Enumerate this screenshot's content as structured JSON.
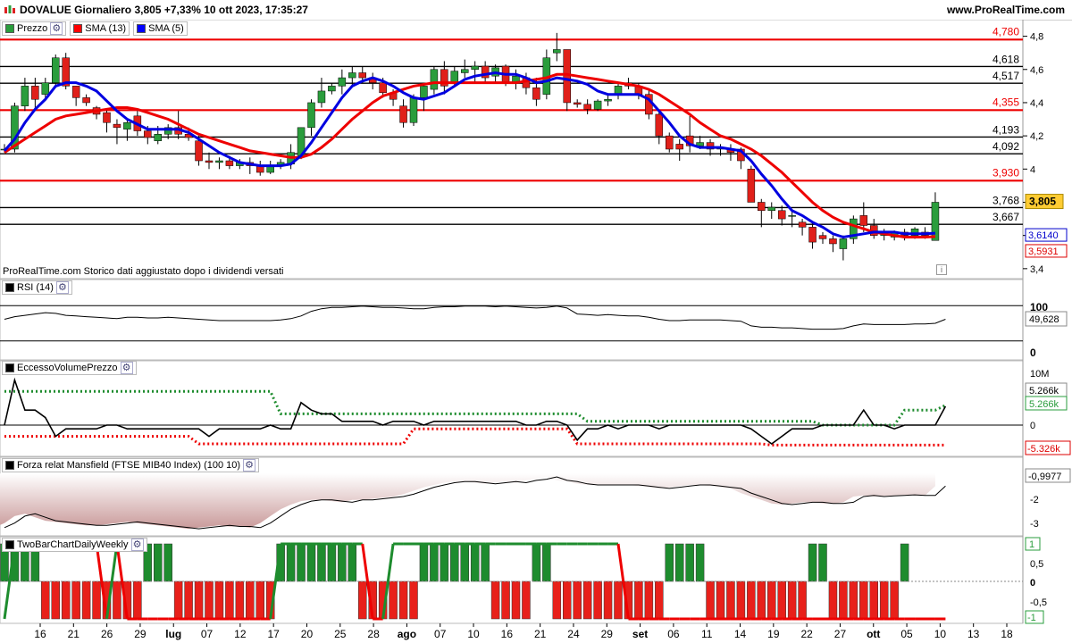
{
  "header": {
    "title": "DOVALUE Giornaliero 3,805 +7,33% 10 ott 2023, 17:35:27",
    "site": "www.ProRealTime.com"
  },
  "price_panel": {
    "legend": [
      {
        "label": "Prezzo",
        "color": "#2a9d3c"
      },
      {
        "label": "SMA (13)",
        "color": "#ff0000"
      },
      {
        "label": "SMA (5)",
        "color": "#0000ff"
      }
    ],
    "note": "ProRealTime.com  Storico dati aggiustato dopo i dividendi versati",
    "info_glyph": "i"
  },
  "rsi_panel": {
    "legend": "RSI (14)",
    "value": "49,628",
    "scale_top": "100",
    "scale_bottom": "0"
  },
  "evp_panel": {
    "legend": "EccessoVolumePrezzo",
    "scale_top": "10M",
    "scale_zero": "0",
    "value_black": "5.266k",
    "value_green": "5.266k",
    "value_red": "-5.326k"
  },
  "mansfield_panel": {
    "legend": "Forza relat Mansfield (FTSE MIB40 Index) (100 10)",
    "value": "-0,9977",
    "ticks": [
      "-2",
      "-3"
    ]
  },
  "twobar_panel": {
    "legend": "TwoBarChartDailyWeekly",
    "value_top": "1",
    "value_bottom": "-1",
    "ticks": [
      "0,5",
      "0",
      "-0,5"
    ]
  },
  "xaxis": {
    "labels": [
      "16",
      "21",
      "26",
      "29",
      "lug",
      "07",
      "12",
      "17",
      "20",
      "25",
      "28",
      "ago",
      "07",
      "10",
      "16",
      "21",
      "24",
      "29",
      "set",
      "06",
      "11",
      "14",
      "19",
      "22",
      "27",
      "ott",
      "05",
      "10",
      "13",
      "18"
    ],
    "bold": [
      "lug",
      "ago",
      "set",
      "ott"
    ]
  },
  "chart_data": {
    "type": "candlestick",
    "price_ticks": [
      4.8,
      4.6,
      4.4,
      4.2,
      4.0,
      3.8,
      3.6,
      3.4
    ],
    "price_tick_labels": [
      "4,8",
      "4,6",
      "4,4",
      "4,2",
      "4",
      "3,8",
      "3,6",
      "3,4"
    ],
    "red_levels": [
      {
        "value": 4.78,
        "label": "4,780"
      },
      {
        "value": 4.355,
        "label": "4,355"
      },
      {
        "value": 3.93,
        "label": "3,930"
      }
    ],
    "black_levels": [
      {
        "value": 4.618,
        "label": "4,618"
      },
      {
        "value": 4.517,
        "label": "4,517"
      },
      {
        "value": 4.193,
        "label": "4,193"
      },
      {
        "value": 4.092,
        "label": "4,092"
      },
      {
        "value": 3.768,
        "label": "3,768"
      },
      {
        "value": 3.667,
        "label": "3,667"
      }
    ],
    "last_price": {
      "value": 3.805,
      "label": "3,805"
    },
    "sma5_last": {
      "value": 3.614,
      "label": "3,6140"
    },
    "sma13_last": {
      "value": 3.5931,
      "label": "3,5931"
    },
    "candles": [
      [
        4.12,
        4.15,
        4.1,
        4.12
      ],
      [
        4.12,
        4.4,
        4.1,
        4.38
      ],
      [
        4.38,
        4.55,
        4.35,
        4.5
      ],
      [
        4.5,
        4.55,
        4.35,
        4.42
      ],
      [
        4.45,
        4.55,
        4.42,
        4.52
      ],
      [
        4.52,
        4.69,
        4.5,
        4.67
      ],
      [
        4.67,
        4.7,
        4.48,
        4.5
      ],
      [
        4.5,
        4.5,
        4.38,
        4.43
      ],
      [
        4.43,
        4.45,
        4.38,
        4.4
      ],
      [
        4.37,
        4.38,
        4.3,
        4.33
      ],
      [
        4.34,
        4.36,
        4.22,
        4.28
      ],
      [
        4.27,
        4.3,
        4.15,
        4.25
      ],
      [
        4.24,
        4.3,
        4.17,
        4.28
      ],
      [
        4.32,
        4.35,
        4.2,
        4.23
      ],
      [
        4.23,
        4.26,
        4.15,
        4.19
      ],
      [
        4.17,
        4.26,
        4.15,
        4.21
      ],
      [
        4.21,
        4.27,
        4.18,
        4.25
      ],
      [
        4.25,
        4.35,
        4.18,
        4.21
      ],
      [
        4.21,
        4.25,
        4.17,
        4.19
      ],
      [
        4.17,
        4.2,
        4.02,
        4.05
      ],
      [
        4.05,
        4.1,
        4.0,
        4.04
      ],
      [
        4.04,
        4.07,
        4.0,
        4.05
      ],
      [
        4.05,
        4.08,
        4.0,
        4.02
      ],
      [
        4.02,
        4.06,
        4.0,
        4.04
      ],
      [
        4.04,
        4.07,
        3.97,
        4.02
      ],
      [
        4.02,
        4.05,
        3.96,
        3.98
      ],
      [
        3.98,
        4.05,
        3.97,
        4.02
      ],
      [
        4.02,
        4.06,
        4.0,
        4.04
      ],
      [
        4.03,
        4.15,
        4.0,
        4.1
      ],
      [
        4.08,
        4.25,
        4.06,
        4.25
      ],
      [
        4.25,
        4.42,
        4.2,
        4.4
      ],
      [
        4.4,
        4.55,
        4.37,
        4.47
      ],
      [
        4.47,
        4.52,
        4.45,
        4.5
      ],
      [
        4.5,
        4.6,
        4.45,
        4.55
      ],
      [
        4.55,
        4.62,
        4.5,
        4.58
      ],
      [
        4.58,
        4.62,
        4.52,
        4.55
      ],
      [
        4.55,
        4.58,
        4.48,
        4.52
      ],
      [
        4.52,
        4.55,
        4.43,
        4.46
      ],
      [
        4.46,
        4.48,
        4.38,
        4.42
      ],
      [
        4.38,
        4.42,
        4.25,
        4.28
      ],
      [
        4.28,
        4.45,
        4.26,
        4.43
      ],
      [
        4.43,
        4.52,
        4.35,
        4.5
      ],
      [
        4.48,
        4.62,
        4.45,
        4.6
      ],
      [
        4.6,
        4.65,
        4.45,
        4.5
      ],
      [
        4.52,
        4.62,
        4.5,
        4.59
      ],
      [
        4.58,
        4.66,
        4.55,
        4.6
      ],
      [
        4.6,
        4.65,
        4.52,
        4.62
      ],
      [
        4.62,
        4.65,
        4.52,
        4.55
      ],
      [
        4.56,
        4.63,
        4.52,
        4.61
      ],
      [
        4.62,
        4.63,
        4.5,
        4.52
      ],
      [
        4.52,
        4.6,
        4.48,
        4.56
      ],
      [
        4.55,
        4.58,
        4.45,
        4.49
      ],
      [
        4.49,
        4.55,
        4.38,
        4.42
      ],
      [
        4.45,
        4.72,
        4.42,
        4.67
      ],
      [
        4.7,
        4.82,
        4.65,
        4.72
      ],
      [
        4.72,
        4.72,
        4.35,
        4.4
      ],
      [
        4.4,
        4.42,
        4.37,
        4.39
      ],
      [
        4.39,
        4.42,
        4.33,
        4.36
      ],
      [
        4.36,
        4.42,
        4.35,
        4.41
      ],
      [
        4.41,
        4.45,
        4.38,
        4.42
      ],
      [
        4.45,
        4.52,
        4.42,
        4.5
      ],
      [
        4.52,
        4.55,
        4.48,
        4.5
      ],
      [
        4.5,
        4.52,
        4.42,
        4.45
      ],
      [
        4.45,
        4.48,
        4.3,
        4.33
      ],
      [
        4.33,
        4.35,
        4.15,
        4.2
      ],
      [
        4.2,
        4.22,
        4.1,
        4.12
      ],
      [
        4.15,
        4.18,
        4.05,
        4.12
      ],
      [
        4.2,
        4.32,
        4.1,
        4.14
      ],
      [
        4.14,
        4.2,
        4.12,
        4.16
      ],
      [
        4.16,
        4.18,
        4.08,
        4.12
      ],
      [
        4.12,
        4.15,
        4.08,
        4.13
      ],
      [
        4.12,
        4.15,
        4.05,
        4.1
      ],
      [
        4.12,
        4.13,
        4.0,
        4.05
      ],
      [
        4.0,
        4.02,
        3.8,
        3.8
      ],
      [
        3.8,
        3.82,
        3.65,
        3.75
      ],
      [
        3.75,
        3.8,
        3.7,
        3.77
      ],
      [
        3.75,
        3.78,
        3.66,
        3.7
      ],
      [
        3.72,
        3.75,
        3.65,
        3.72
      ],
      [
        3.68,
        3.7,
        3.6,
        3.65
      ],
      [
        3.65,
        3.68,
        3.52,
        3.56
      ],
      [
        3.6,
        3.62,
        3.55,
        3.58
      ],
      [
        3.58,
        3.6,
        3.5,
        3.55
      ],
      [
        3.52,
        3.6,
        3.45,
        3.58
      ],
      [
        3.58,
        3.72,
        3.55,
        3.7
      ],
      [
        3.72,
        3.8,
        3.62,
        3.66
      ],
      [
        3.66,
        3.7,
        3.58,
        3.6
      ],
      [
        3.6,
        3.64,
        3.57,
        3.61
      ],
      [
        3.59,
        3.63,
        3.57,
        3.62
      ],
      [
        3.62,
        3.64,
        3.57,
        3.6
      ],
      [
        3.6,
        3.65,
        3.58,
        3.64
      ],
      [
        3.62,
        3.65,
        3.58,
        3.6
      ],
      [
        3.57,
        3.86,
        3.57,
        3.8
      ]
    ],
    "sma5": [
      4.11,
      4.18,
      4.28,
      4.36,
      4.42,
      4.5,
      4.52,
      4.52,
      4.5,
      4.47,
      4.41,
      4.35,
      4.3,
      4.27,
      4.24,
      4.24,
      4.24,
      4.24,
      4.22,
      4.18,
      4.14,
      4.1,
      4.07,
      4.04,
      4.03,
      4.02,
      4.02,
      4.02,
      4.03,
      4.08,
      4.16,
      4.25,
      4.34,
      4.43,
      4.5,
      4.53,
      4.55,
      4.53,
      4.5,
      4.46,
      4.43,
      4.42,
      4.44,
      4.46,
      4.5,
      4.54,
      4.56,
      4.57,
      4.58,
      4.57,
      4.57,
      4.55,
      4.52,
      4.53,
      4.55,
      4.54,
      4.53,
      4.51,
      4.47,
      4.45,
      4.45,
      4.45,
      4.45,
      4.42,
      4.35,
      4.28,
      4.2,
      4.15,
      4.13,
      4.13,
      4.13,
      4.12,
      4.11,
      4.05,
      3.97,
      3.9,
      3.82,
      3.75,
      3.72,
      3.68,
      3.65,
      3.61,
      3.59,
      3.6,
      3.61,
      3.62,
      3.62,
      3.62,
      3.61,
      3.61,
      3.61,
      3.614
    ],
    "sma13": [
      4.1,
      4.14,
      4.18,
      4.22,
      4.26,
      4.3,
      4.32,
      4.33,
      4.34,
      4.35,
      4.36,
      4.37,
      4.37,
      4.36,
      4.34,
      4.32,
      4.3,
      4.27,
      4.24,
      4.21,
      4.19,
      4.17,
      4.15,
      4.13,
      4.11,
      4.1,
      4.09,
      4.08,
      4.07,
      4.07,
      4.09,
      4.13,
      4.18,
      4.24,
      4.3,
      4.35,
      4.4,
      4.44,
      4.46,
      4.48,
      4.5,
      4.51,
      4.52,
      4.52,
      4.52,
      4.52,
      4.52,
      4.52,
      4.52,
      4.52,
      4.52,
      4.53,
      4.54,
      4.55,
      4.57,
      4.57,
      4.56,
      4.55,
      4.54,
      4.53,
      4.52,
      4.51,
      4.5,
      4.48,
      4.45,
      4.41,
      4.37,
      4.33,
      4.28,
      4.24,
      4.2,
      4.18,
      4.15,
      4.12,
      4.08,
      4.03,
      3.98,
      3.92,
      3.86,
      3.8,
      3.75,
      3.71,
      3.68,
      3.66,
      3.64,
      3.62,
      3.61,
      3.6,
      3.59,
      3.59,
      3.59,
      3.5931
    ],
    "rsi": [
      52,
      56,
      58,
      60,
      62,
      61,
      58,
      57,
      56,
      55,
      54,
      53,
      55,
      55,
      54,
      54,
      55,
      54,
      53,
      52,
      51,
      50,
      50,
      50,
      50,
      50,
      50,
      51,
      53,
      57,
      64,
      68,
      70,
      70,
      71,
      72,
      71,
      70,
      70,
      69,
      68,
      68,
      70,
      71,
      71,
      72,
      72,
      72,
      71,
      72,
      71,
      70,
      69,
      70,
      72,
      69,
      60,
      59,
      58,
      59,
      58,
      57,
      57,
      55,
      52,
      50,
      50,
      51,
      51,
      51,
      51,
      50,
      49,
      42,
      40,
      40,
      39,
      39,
      38,
      37,
      37,
      37,
      38,
      42,
      45,
      44,
      44,
      44,
      44,
      45,
      45,
      46,
      52
    ],
    "evp_black": [
      0,
      12,
      4,
      4,
      2,
      -3,
      -1,
      -1,
      -1,
      -1,
      0,
      0,
      -1,
      -1,
      -1,
      -1,
      -1,
      -1,
      -1,
      -1,
      -3,
      -1,
      -1,
      -1,
      -1,
      -1,
      0,
      -1,
      -1,
      6,
      4,
      3,
      3,
      1,
      1,
      1,
      1,
      0,
      1,
      1,
      1,
      0,
      1,
      1,
      1,
      1,
      1,
      1,
      1,
      1,
      1,
      0,
      0,
      1,
      1,
      0,
      -4,
      -1,
      -1,
      0,
      -1,
      0,
      0,
      0,
      -1,
      0,
      0,
      0,
      0,
      0,
      0,
      0,
      0,
      -1,
      -3,
      -5,
      -3,
      -1,
      -1,
      -1,
      0,
      0,
      0,
      0,
      4,
      0,
      0,
      -1,
      0,
      0,
      0,
      0,
      5
    ],
    "evp_green": [
      9,
      9,
      9,
      9,
      9,
      9,
      9,
      9,
      9,
      9,
      9,
      9,
      9,
      9,
      9,
      9,
      9,
      9,
      9,
      9,
      9,
      9,
      9,
      9,
      9,
      9,
      9,
      3,
      3,
      3,
      3,
      3,
      3,
      3,
      3,
      3,
      3,
      3,
      3,
      3,
      3,
      3,
      3,
      3,
      3,
      3,
      3,
      3,
      3,
      3,
      3,
      3,
      3,
      3,
      3,
      3,
      3,
      1,
      1,
      1,
      1,
      1,
      1,
      1,
      1,
      1,
      1,
      1,
      1,
      1,
      1,
      1,
      1,
      1,
      1,
      1,
      1,
      1,
      1,
      1,
      0,
      0,
      0,
      0,
      0,
      0,
      0,
      0,
      4,
      4,
      4,
      4,
      5.266
    ],
    "evp_red": [
      -3,
      -3,
      -3,
      -3,
      -3,
      -3,
      -3,
      -3,
      -3,
      -3,
      -3,
      -3,
      -3,
      -3,
      -3,
      -3,
      -3,
      -3,
      -3,
      -5,
      -5,
      -5,
      -5,
      -5,
      -5,
      -5,
      -5,
      -5,
      -5,
      -5,
      -5,
      -5,
      -5,
      -5,
      -5,
      -5,
      -5,
      -5,
      -5,
      -5,
      -1,
      -1,
      -1,
      -1,
      -1,
      -1,
      -1,
      -1,
      -1,
      -1,
      -1,
      -1,
      -1,
      -1,
      -1,
      -1,
      -5,
      -5,
      -5,
      -5,
      -5,
      -5,
      -5,
      -5,
      -5,
      -5,
      -5,
      -5,
      -5,
      -5,
      -5,
      -5,
      -5,
      -5,
      -5,
      -5.326,
      -5.326,
      -5.326,
      -5.326,
      -5.326,
      -5.326,
      -5.326,
      -5.326,
      -5.326,
      -5.326,
      -5.326,
      -5.326,
      -5.326,
      -5.326,
      -5.326,
      -5.326,
      -5.326,
      -5.326
    ],
    "mansfield": [
      -2.8,
      -2.6,
      -2.3,
      -2.2,
      -2.35,
      -2.5,
      -2.55,
      -2.6,
      -2.65,
      -2.7,
      -2.7,
      -2.65,
      -2.6,
      -2.55,
      -2.6,
      -2.65,
      -2.7,
      -2.75,
      -2.8,
      -2.85,
      -2.8,
      -2.75,
      -2.7,
      -2.75,
      -2.75,
      -2.8,
      -2.6,
      -2.3,
      -2.0,
      -1.8,
      -1.65,
      -1.6,
      -1.6,
      -1.65,
      -1.7,
      -1.6,
      -1.6,
      -1.55,
      -1.5,
      -1.45,
      -1.35,
      -1.2,
      -1.05,
      -0.95,
      -0.85,
      -0.8,
      -0.8,
      -0.85,
      -0.9,
      -0.85,
      -0.8,
      -0.85,
      -0.75,
      -0.7,
      -0.6,
      -0.75,
      -0.8,
      -0.9,
      -0.95,
      -0.95,
      -0.95,
      -0.95,
      -0.95,
      -1.0,
      -1.05,
      -1.1,
      -1.05,
      -1.0,
      -0.95,
      -0.95,
      -1.0,
      -1.05,
      -1.1,
      -1.3,
      -1.45,
      -1.6,
      -1.75,
      -1.8,
      -1.75,
      -1.7,
      -1.7,
      -1.75,
      -1.75,
      -1.7,
      -1.45,
      -1.4,
      -1.45,
      -1.42,
      -1.4,
      -1.38,
      -1.4,
      -1.4,
      -1.0
    ],
    "twobar_bars": [
      1,
      1,
      1,
      1,
      -1,
      -1,
      -1,
      -1,
      -1,
      -1,
      -1,
      -1,
      -1,
      -1,
      1,
      1,
      1,
      -1,
      -1,
      -1,
      -1,
      -1,
      -1,
      -1,
      -1,
      -1,
      -1,
      1,
      1,
      1,
      1,
      1,
      1,
      1,
      1,
      -1,
      -1,
      -1,
      -1,
      -1,
      -1,
      1,
      1,
      1,
      1,
      1,
      1,
      1,
      -1,
      -1,
      -1,
      -1,
      1,
      1,
      -1,
      -1,
      -1,
      -1,
      -1,
      -1,
      -1,
      -1,
      -1,
      -1,
      -1,
      1,
      1,
      1,
      1,
      -1,
      -1,
      -1,
      -1,
      -1,
      -1,
      -1,
      -1,
      -1,
      -1,
      1,
      1,
      -1,
      -1,
      -1,
      -1,
      -1,
      -1,
      -1,
      1
    ],
    "twobar_line": [
      -1,
      1,
      1,
      1,
      1,
      1,
      1,
      1,
      1,
      1,
      -1,
      1,
      -1,
      -1,
      -1,
      -1,
      -1,
      -1,
      -1,
      -1,
      -1,
      -1,
      -1,
      -1,
      -1,
      -1,
      -1,
      1,
      1,
      1,
      1,
      1,
      1,
      1,
      1,
      1,
      -1,
      -1,
      1,
      1,
      1,
      1,
      1,
      1,
      1,
      1,
      1,
      1,
      1,
      1,
      1,
      1,
      1,
      1,
      1,
      1,
      1,
      1,
      1,
      1,
      1,
      -1,
      -1,
      -1,
      -1,
      -1,
      -1,
      -1,
      -1,
      -1,
      -1,
      -1,
      -1,
      -1,
      -1,
      -1,
      -1,
      -1,
      -1,
      -1,
      -1,
      -1,
      -1,
      -1,
      -1,
      -1,
      -1,
      -1,
      -1,
      -1,
      -1,
      -1,
      -1
    ]
  }
}
